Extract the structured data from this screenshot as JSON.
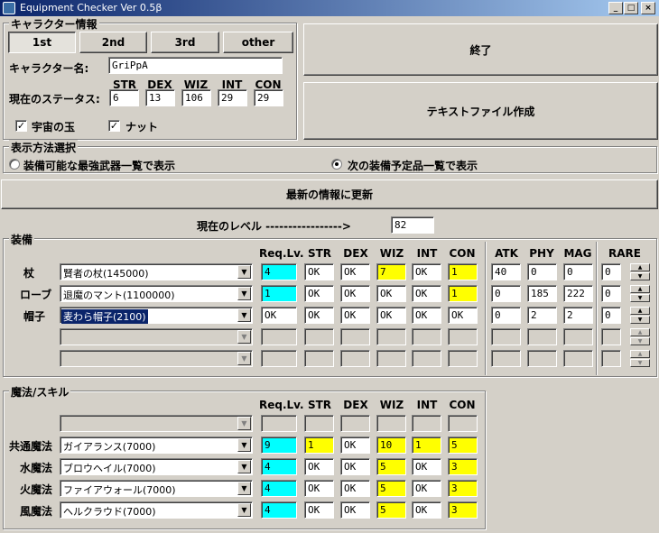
{
  "window": {
    "title": "Equipment Checker Ver 0.5β",
    "min_label": "_",
    "max_label": "□",
    "close_label": "×"
  },
  "character": {
    "group_title": "キャラクター情報",
    "tabs": [
      "1st",
      "2nd",
      "3rd",
      "other"
    ],
    "active_tab": "1st",
    "name_label": "キャラクター名:",
    "name_value": "GriPpA",
    "status_label": "現在のステータス:",
    "stats": [
      {
        "name": "STR",
        "value": "6"
      },
      {
        "name": "DEX",
        "value": "13"
      },
      {
        "name": "WIZ",
        "value": "106"
      },
      {
        "name": "INT",
        "value": "29"
      },
      {
        "name": "CON",
        "value": "29"
      }
    ],
    "checks": [
      {
        "label": "宇宙の玉",
        "checked": true
      },
      {
        "label": "ナット",
        "checked": true
      }
    ]
  },
  "actions": {
    "exit_label": "終了",
    "textfile_label": "テキストファイル作成",
    "refresh_label": "最新の情報に更新"
  },
  "display_mode": {
    "group_title": "表示方法選択",
    "options": [
      {
        "label": "装備可能な最強武器一覧で表示",
        "selected": false
      },
      {
        "label": "次の装備予定品一覧で表示",
        "selected": true
      }
    ]
  },
  "level": {
    "label": "現在のレベル ----------------->",
    "value": "82"
  },
  "equipment": {
    "group_title": "装備",
    "headers": [
      "Req.Lv.",
      "STR",
      "DEX",
      "WIZ",
      "INT",
      "CON",
      "ATK",
      "PHY",
      "MAG",
      "RARE"
    ],
    "rows": [
      {
        "slot": "杖",
        "item": "賢者の杖(145000)",
        "req": "4",
        "str": "OK",
        "dex": "OK",
        "wiz": "7",
        "int": "OK",
        "con": "1",
        "atk": "40",
        "phy": "0",
        "mag": "0",
        "rare": "0"
      },
      {
        "slot": "ローブ",
        "item": "退魔のマント(1100000)",
        "req": "1",
        "str": "OK",
        "dex": "OK",
        "wiz": "OK",
        "int": "OK",
        "con": "1",
        "atk": "0",
        "phy": "185",
        "mag": "222",
        "rare": "0"
      },
      {
        "slot": "帽子",
        "item": "麦わら帽子(2100)",
        "req": "OK",
        "str": "OK",
        "dex": "OK",
        "wiz": "OK",
        "int": "OK",
        "con": "OK",
        "atk": "0",
        "phy": "2",
        "mag": "2",
        "rare": "0"
      },
      {
        "slot": "",
        "item": "",
        "req": "",
        "str": "",
        "dex": "",
        "wiz": "",
        "int": "",
        "con": "",
        "atk": "",
        "phy": "",
        "mag": "",
        "rare": ""
      },
      {
        "slot": "",
        "item": "",
        "req": "",
        "str": "",
        "dex": "",
        "wiz": "",
        "int": "",
        "con": "",
        "atk": "",
        "phy": "",
        "mag": "",
        "rare": ""
      }
    ]
  },
  "magic": {
    "group_title": "魔法/スキル",
    "headers": [
      "Req.Lv.",
      "STR",
      "DEX",
      "WIZ",
      "INT",
      "CON"
    ],
    "rows": [
      {
        "slot": "",
        "item": "",
        "req": "",
        "str": "",
        "dex": "",
        "wiz": "",
        "int": "",
        "con": ""
      },
      {
        "slot": "共通魔法",
        "item": "ガイアランス(7000)",
        "req": "9",
        "str": "1",
        "dex": "OK",
        "wiz": "10",
        "int": "1",
        "con": "5"
      },
      {
        "slot": "水魔法",
        "item": "ブロウヘイル(7000)",
        "req": "4",
        "str": "OK",
        "dex": "OK",
        "wiz": "5",
        "int": "OK",
        "con": "3"
      },
      {
        "slot": "火魔法",
        "item": "ファイアウォール(7000)",
        "req": "4",
        "str": "OK",
        "dex": "OK",
        "wiz": "5",
        "int": "OK",
        "con": "3"
      },
      {
        "slot": "風魔法",
        "item": "ヘルクラウド(7000)",
        "req": "4",
        "str": "OK",
        "dex": "OK",
        "wiz": "5",
        "int": "OK",
        "con": "3"
      }
    ]
  },
  "colors": {
    "requirement_unmet_level": "#00ffff",
    "requirement_unmet_stat": "#ffff00",
    "window_bg": "#d4d0c8"
  }
}
